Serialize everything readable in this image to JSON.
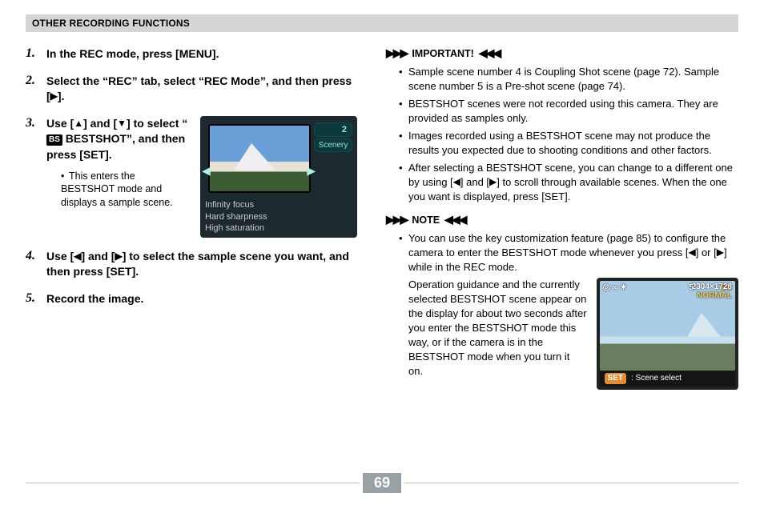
{
  "header": {
    "title": "OTHER RECORDING FUNCTIONS"
  },
  "page_number": "69",
  "steps": [
    {
      "num": "1.",
      "title_parts": [
        "In the REC mode, press [MENU]."
      ]
    },
    {
      "num": "2.",
      "title_parts": [
        "Select the “REC” tab, select “REC Mode”, and then press [",
        "▶",
        "]."
      ]
    },
    {
      "num": "3.",
      "title_before": "Use [",
      "tri_up": "▲",
      "mid1": "] and [",
      "tri_down": "▼",
      "mid2": "] to select “",
      "bs_badge": "BS",
      "after_bs": " BESTSHOT”, and then press [SET].",
      "sub": "This enters the BESTSHOT mode and displays a sample scene.",
      "lcd": {
        "count": "2",
        "scenery": "Scenery",
        "line1": "Infinity focus",
        "line2": "Hard sharpness",
        "line3": "High saturation"
      }
    },
    {
      "num": "4.",
      "t1": "Use [",
      "tri_left": "◀",
      "t2": "] and [",
      "tri_right": "▶",
      "t3": "] to select the sample scene you want, and then press [SET]."
    },
    {
      "num": "5.",
      "title_parts": [
        "Record the image."
      ]
    }
  ],
  "important": {
    "label": "IMPORTANT!",
    "orn_left": "▶▶▶",
    "orn_right": "◀◀◀",
    "items": [
      "Sample scene number 4 is Coupling Shot scene (page 72). Sample scene number 5 is a Pre-shot scene (page 74).",
      "BESTSHOT scenes were not recorded using this camera. They are provided as samples only.",
      "Images recorded using a BESTSHOT scene may not produce the results you expected due to shooting conditions and other factors."
    ],
    "last_item": {
      "p1": "After selecting a BESTSHOT scene, you can change to a different one by using [",
      "tri_left": "◀",
      "p2": "] and [",
      "tri_right": "▶",
      "p3": "] to scroll through available scenes. When the one you want is displayed, press [SET]."
    }
  },
  "note": {
    "label": "NOTE",
    "orn_left": "▶▶▶",
    "orn_right": "◀◀◀",
    "item": {
      "p1": "You can use the key customization feature (page 85) to configure the camera to enter the BESTSHOT mode whenever you press [",
      "tri_left": "◀",
      "p2": "] or [",
      "tri_right": "▶",
      "p3": "] while in the REC mode.",
      "cont": "Operation guidance and the currently selected BESTSHOT scene appear on the display for about two seconds after you enter the BESTSHOT mode this way, or if the camera is in the BESTSHOT mode when you turn it on."
    },
    "lcd": {
      "top_icons": "◎ ∞ ☀",
      "bs": "BS",
      "frame_count": "5",
      "res": "2304×1728",
      "normal": "NORMAL",
      "set": "SET",
      "scene_select": ": Scene select"
    }
  }
}
